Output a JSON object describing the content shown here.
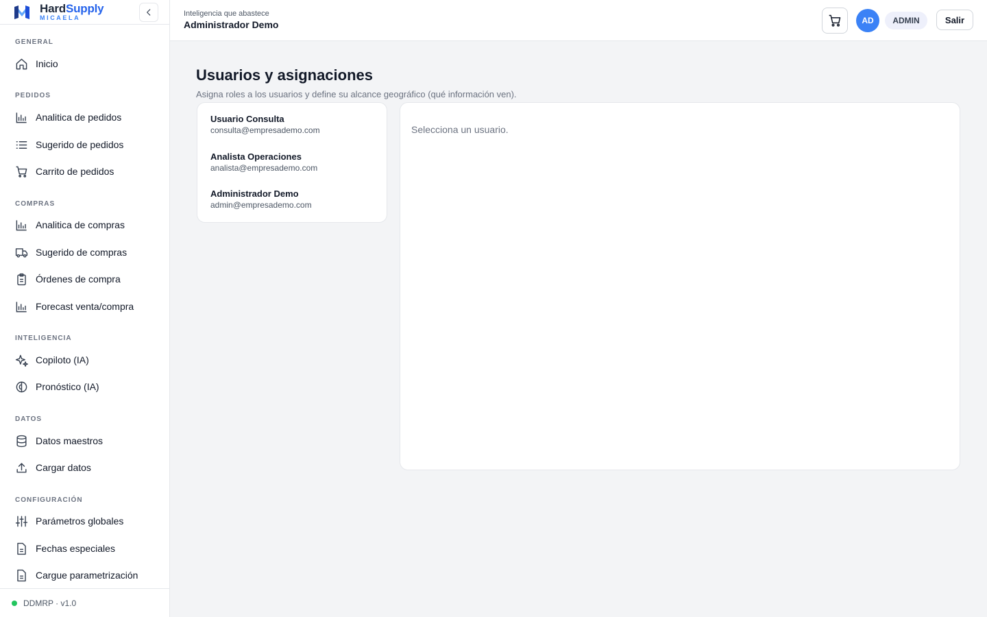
{
  "brand": {
    "name_part1": "Hard",
    "name_part2": "Supply",
    "subtitle": "MICAELA",
    "colors": {
      "primary": "#2563eb",
      "dark": "#1e293b"
    }
  },
  "sidebar": {
    "sections": [
      {
        "title": "GENERAL",
        "items": [
          {
            "label": "Inicio",
            "icon": "home-icon"
          }
        ]
      },
      {
        "title": "PEDIDOS",
        "items": [
          {
            "label": "Analitica de pedidos",
            "icon": "bar-chart-icon"
          },
          {
            "label": "Sugerido de pedidos",
            "icon": "list-icon"
          },
          {
            "label": "Carrito de pedidos",
            "icon": "cart-icon"
          }
        ]
      },
      {
        "title": "COMPRAS",
        "items": [
          {
            "label": "Analitica de compras",
            "icon": "bar-chart-icon"
          },
          {
            "label": "Sugerido de compras",
            "icon": "truck-icon"
          },
          {
            "label": "Órdenes de compra",
            "icon": "clipboard-icon"
          },
          {
            "label": "Forecast venta/compra",
            "icon": "bar-chart-icon"
          }
        ]
      },
      {
        "title": "INTELIGENCIA",
        "items": [
          {
            "label": "Copiloto (IA)",
            "icon": "sparkles-icon"
          },
          {
            "label": "Pronóstico (IA)",
            "icon": "brain-icon"
          }
        ]
      },
      {
        "title": "DATOS",
        "items": [
          {
            "label": "Datos maestros",
            "icon": "database-icon"
          },
          {
            "label": "Cargar datos",
            "icon": "upload-icon"
          }
        ]
      },
      {
        "title": "CONFIGURACIÓN",
        "items": [
          {
            "label": "Parámetros globales",
            "icon": "sliders-icon"
          },
          {
            "label": "Fechas especiales",
            "icon": "file-icon"
          },
          {
            "label": "Cargue parametrización",
            "icon": "file-icon"
          }
        ]
      }
    ],
    "footer": {
      "version": "DDMRP · v1.0",
      "status_color": "#22c55e"
    }
  },
  "header": {
    "subtitle": "Inteligencia que abastece",
    "title": "Administrador Demo",
    "avatar_initials": "AD",
    "role": "ADMIN",
    "logout_label": "Salir",
    "avatar_color": "#3b82f6"
  },
  "main": {
    "title": "Usuarios y asignaciones",
    "description": "Asigna roles a los usuarios y define su alcance geográfico (qué información ven).",
    "users": [
      {
        "name": "Usuario Consulta",
        "email": "consulta@empresademo.com"
      },
      {
        "name": "Analista Operaciones",
        "email": "analista@empresademo.com"
      },
      {
        "name": "Administrador Demo",
        "email": "admin@empresademo.com"
      }
    ],
    "empty_state": "Selecciona un usuario."
  }
}
